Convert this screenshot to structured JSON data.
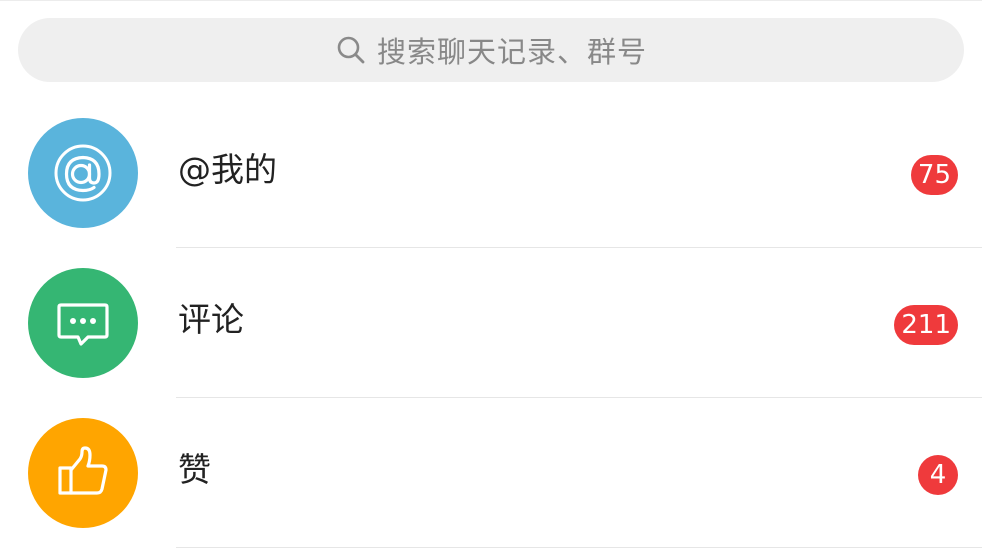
{
  "search": {
    "placeholder": "搜索聊天记录、群号",
    "icon": "search-icon"
  },
  "rows": [
    {
      "label": "@我的",
      "badge": "75",
      "icon": "at-icon",
      "color": "#5ab4dc"
    },
    {
      "label": "评论",
      "badge": "211",
      "icon": "comment-icon",
      "color": "#35b673"
    },
    {
      "label": "赞",
      "badge": "4",
      "icon": "thumbs-up-icon",
      "color": "#ffa500"
    }
  ],
  "colors": {
    "badge": "#ef3a3c",
    "search_bg": "#efefef",
    "text": "#222222"
  }
}
